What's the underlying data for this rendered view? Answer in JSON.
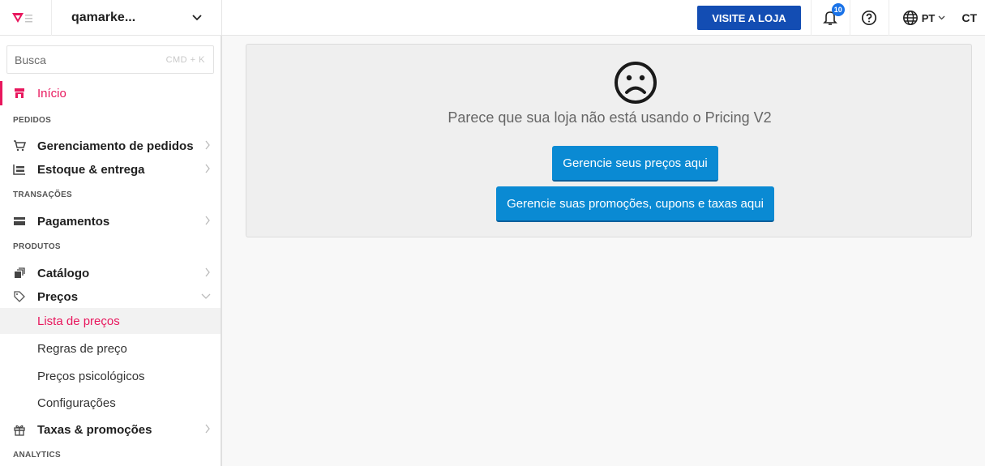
{
  "header": {
    "store_name": "qamarke...",
    "visit_store_label": "VISITE A LOJA",
    "notification_count": "10",
    "language": "PT",
    "avatar_initials": "CT"
  },
  "sidebar": {
    "search_placeholder": "Busca",
    "search_shortcut": "CMD + K",
    "home_label": "Início",
    "sections": {
      "orders": "PEDIDOS",
      "transactions": "TRANSAÇÕES",
      "products": "PRODUTOS",
      "analytics": "ANALYTICS"
    },
    "items": {
      "order_management": "Gerenciamento de pedidos",
      "stock_delivery": "Estoque & entrega",
      "payments": "Pagamentos",
      "catalog": "Catálogo",
      "prices": "Preços",
      "taxes_promotions": "Taxas & promoções"
    },
    "price_subitems": [
      "Lista de preços",
      "Regras de preço",
      "Preços psicológicos",
      "Configurações"
    ]
  },
  "main": {
    "message": "Parece que sua loja não está usando o Pricing V2",
    "manage_prices_button": "Gerencie seus preços aqui",
    "manage_promotions_button": "Gerencie suas promoções, cupons e taxas aqui"
  },
  "colors": {
    "brand_pink": "#e8175d",
    "visit_button": "#134db3",
    "cta_button": "#0a8ad3"
  }
}
